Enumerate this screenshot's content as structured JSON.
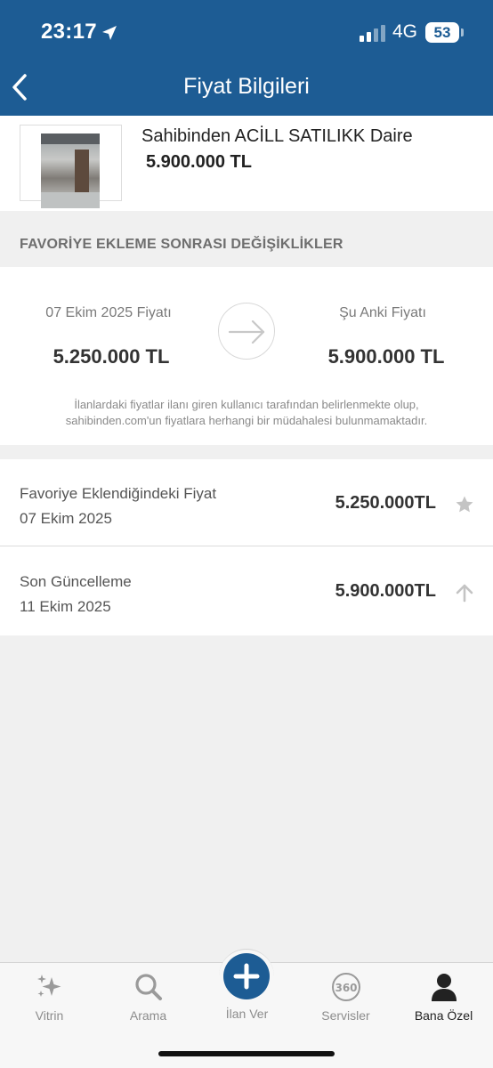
{
  "status_bar": {
    "time": "23:17",
    "network": "4G",
    "battery": "53"
  },
  "header": {
    "title": "Fiyat Bilgileri"
  },
  "listing": {
    "title": "Sahibinden ACİLL SATILIKK Daire",
    "price": "5.900.000 TL"
  },
  "section": {
    "title": "FAVORİYE EKLEME SONRASI DEĞİŞİKLİKLER"
  },
  "comparison": {
    "left_label": "07 Ekim 2025 Fiyatı",
    "left_value": "5.250.000 TL",
    "right_label": "Şu Anki Fiyatı",
    "right_value": "5.900.000 TL",
    "disclaimer_line1": "İlanlardaki fiyatlar ilanı giren kullanıcı tarafından belirlenmekte olup,",
    "disclaimer_line2": "sahibinden.com'un fiyatlara herhangi bir müdahalesi bulunmamaktadır."
  },
  "history": [
    {
      "label": "Favoriye Eklendiğindeki Fiyat",
      "date": "07 Ekim 2025",
      "value": "5.250.000TL",
      "icon": "star-icon"
    },
    {
      "label": "Son Güncelleme",
      "date": "11 Ekim 2025",
      "value": "5.900.000TL",
      "icon": "arrow-up-icon"
    }
  ],
  "tabs": [
    {
      "label": "Vitrin",
      "icon": "sparkles-icon"
    },
    {
      "label": "Arama",
      "icon": "search-icon"
    },
    {
      "label": "İlan Ver",
      "icon": "plus-icon"
    },
    {
      "label": "Servisler",
      "icon": "360-icon"
    },
    {
      "label": "Bana Özel",
      "icon": "person-icon",
      "active": true
    }
  ],
  "colors": {
    "brand": "#1d5c94",
    "background": "#f0f0f0",
    "icon_gray": "#c2c2c2"
  }
}
